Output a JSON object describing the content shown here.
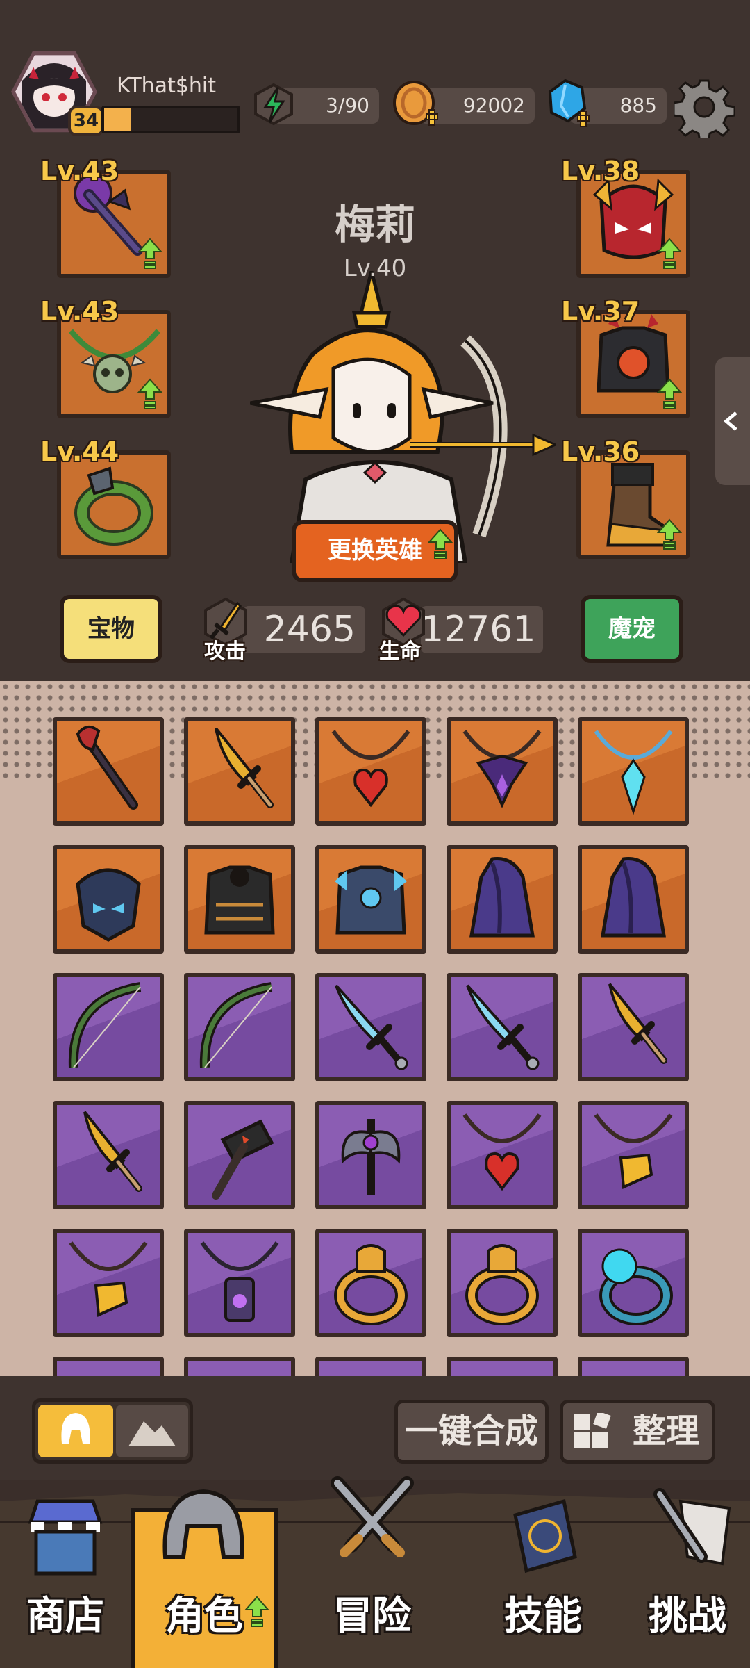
{
  "player": {
    "name": "KThat$hit",
    "level": "34",
    "xp_fraction": 0.2
  },
  "resources": {
    "energy": "3/90",
    "gold": "92002",
    "gems": "885"
  },
  "hero": {
    "name": "梅莉",
    "level": "Lv.40",
    "change_label": "更换英雄"
  },
  "equipment": {
    "left": [
      {
        "level": "Lv.43"
      },
      {
        "level": "Lv.43"
      },
      {
        "level": "Lv.44"
      }
    ],
    "right": [
      {
        "level": "Lv.38"
      },
      {
        "level": "Lv.37"
      },
      {
        "level": "Lv.36"
      }
    ]
  },
  "buttons": {
    "treasure": "宝物",
    "pet": "魔宠",
    "merge": "一键合成",
    "sort": "整理"
  },
  "stats": {
    "attack_label": "攻击",
    "attack": "2465",
    "hp_label": "生命",
    "hp": "12761"
  },
  "inventory": [
    {
      "type": "staff",
      "rarity": "orange"
    },
    {
      "type": "sword-gold",
      "rarity": "orange"
    },
    {
      "type": "amulet-heart",
      "rarity": "orange"
    },
    {
      "type": "amulet-dark",
      "rarity": "orange"
    },
    {
      "type": "amulet-crystal",
      "rarity": "orange"
    },
    {
      "type": "helmet-dark",
      "rarity": "orange"
    },
    {
      "type": "armor-dark",
      "rarity": "orange"
    },
    {
      "type": "armor-blue",
      "rarity": "orange"
    },
    {
      "type": "cloak",
      "rarity": "orange"
    },
    {
      "type": "cloak",
      "rarity": "orange"
    },
    {
      "type": "bow",
      "rarity": "purple"
    },
    {
      "type": "bow",
      "rarity": "purple"
    },
    {
      "type": "sword-ice",
      "rarity": "purple"
    },
    {
      "type": "sword-ice",
      "rarity": "purple"
    },
    {
      "type": "sword-gold",
      "rarity": "purple"
    },
    {
      "type": "sword-gold",
      "rarity": "purple"
    },
    {
      "type": "hammer",
      "rarity": "purple"
    },
    {
      "type": "axe",
      "rarity": "purple"
    },
    {
      "type": "amulet-heart",
      "rarity": "purple"
    },
    {
      "type": "amulet-axe",
      "rarity": "purple"
    },
    {
      "type": "amulet-axe",
      "rarity": "purple"
    },
    {
      "type": "amulet-lantern",
      "rarity": "purple"
    },
    {
      "type": "ring-gold",
      "rarity": "purple"
    },
    {
      "type": "ring-gold",
      "rarity": "purple"
    },
    {
      "type": "ring-blue",
      "rarity": "purple"
    }
  ],
  "nav": [
    {
      "label": "商店",
      "icon": "shop-icon"
    },
    {
      "label": "角色",
      "icon": "helmet-icon"
    },
    {
      "label": "冒险",
      "icon": "crossed-swords-icon"
    },
    {
      "label": "技能",
      "icon": "spellbook-icon"
    },
    {
      "label": "挑战",
      "icon": "challenge-sword-icon"
    }
  ],
  "colors": {
    "background": "#3e332f",
    "inventory_bg": "#cdb4a6",
    "orange_rarity": "#d97a35",
    "purple_rarity": "#8b5db3",
    "accent": "#f5bd3b"
  }
}
